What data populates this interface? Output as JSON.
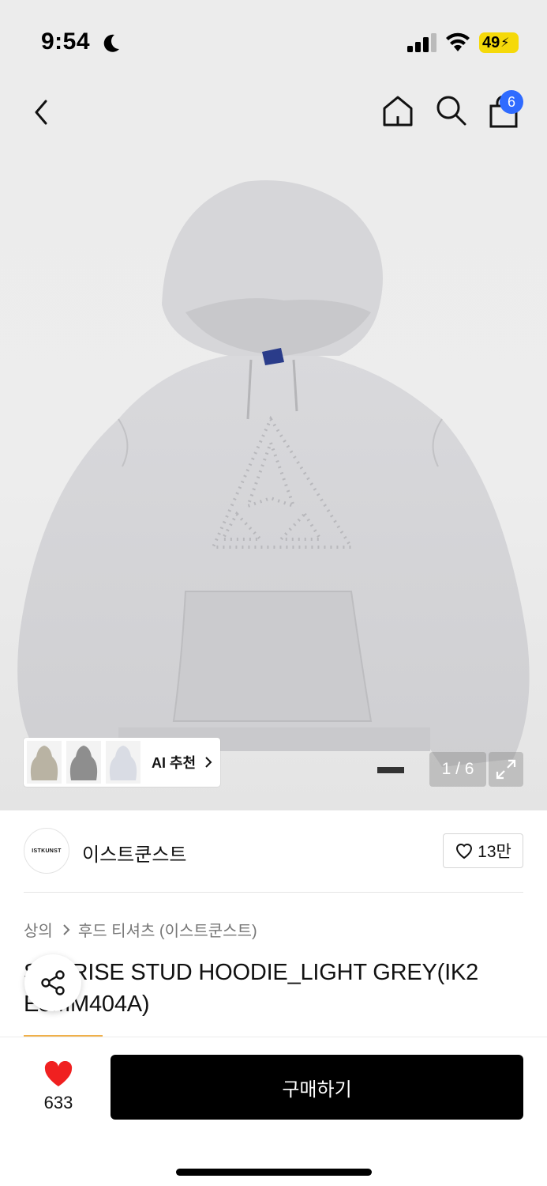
{
  "status_bar": {
    "time": "9:54",
    "battery": "49",
    "icons": [
      "moon-icon",
      "signal-icon",
      "wifi-icon",
      "battery-icon"
    ]
  },
  "nav": {
    "back_icon": "chevron-left-icon",
    "home_icon": "home-icon",
    "search_icon": "search-icon",
    "cart_icon": "shopping-bag-icon",
    "cart_count": "6",
    "badge_color": "#2f6bff"
  },
  "gallery": {
    "page_counter": "1 / 6",
    "ai_label": "AI 추천",
    "thumbnail_count": 3,
    "expand_icon": "expand-icon"
  },
  "brand": {
    "logo_text": "ISTKUNST",
    "name": "이스트쿤스트",
    "like_count": "13만"
  },
  "breadcrumb": {
    "items": [
      "상의",
      "후드 티셔츠 (이스트쿤스트)"
    ]
  },
  "product": {
    "title": "SUNRISE STUD HOODIE_LIGHT GREY(IK2 E5MM404A)"
  },
  "bottom_bar": {
    "wish_count": "633",
    "buy_label": "구매하기",
    "heart_color": "#f02020"
  }
}
